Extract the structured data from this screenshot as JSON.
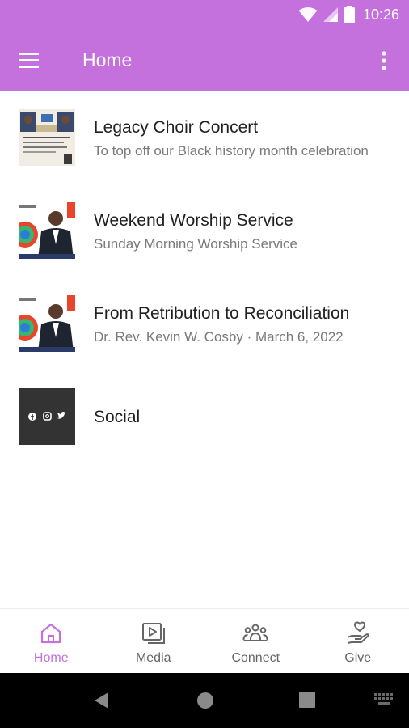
{
  "status_bar": {
    "time": "10:26"
  },
  "app_bar": {
    "title": "Home"
  },
  "feed": {
    "items": [
      {
        "title": "Legacy Choir Concert",
        "subtitle": "To top off our Black history month celebration"
      },
      {
        "title": "Weekend Worship Service",
        "subtitle": "Sunday Morning Worship Service"
      },
      {
        "title": "From Retribution to Reconciliation",
        "subtitle": "Dr. Rev. Kevin W. Cosby · March 6, 2022"
      },
      {
        "title": "Social"
      }
    ]
  },
  "bottom_nav": {
    "items": [
      {
        "label": "Home",
        "icon": "home-icon",
        "active": true
      },
      {
        "label": "Media",
        "icon": "media-icon"
      },
      {
        "label": "Connect",
        "icon": "connect-icon"
      },
      {
        "label": "Give",
        "icon": "give-icon"
      }
    ]
  },
  "colors": {
    "accent": "#c470dd",
    "text": "#212121",
    "subtext": "#7a7a7a",
    "inactive": "#666666"
  }
}
